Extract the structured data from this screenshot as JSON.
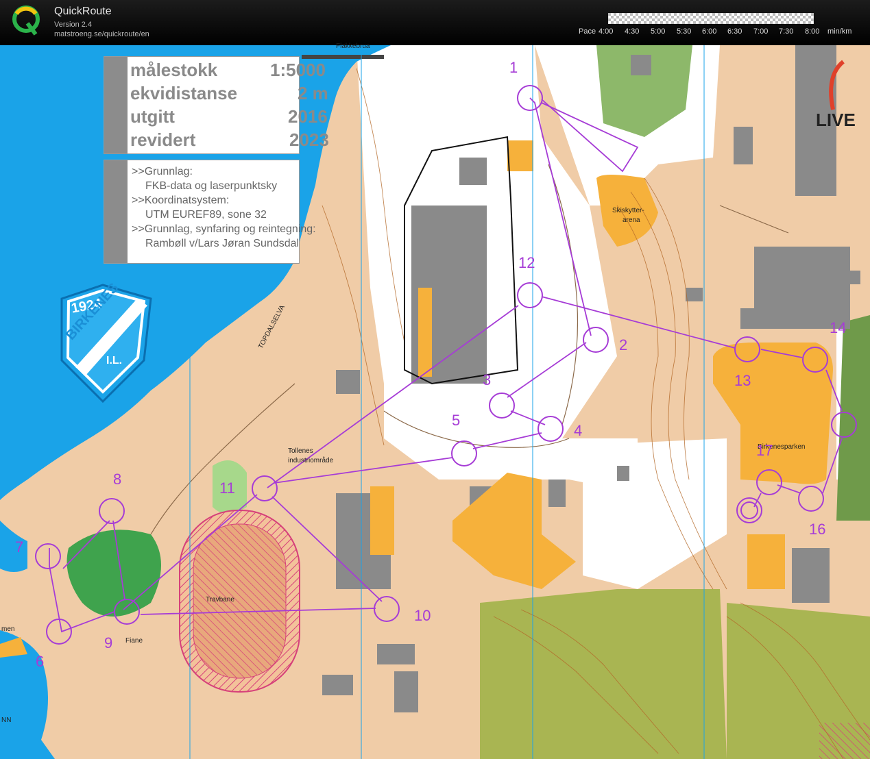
{
  "app": {
    "name": "QuickRoute",
    "version": "Version 2.4",
    "url": "matstroeng.se/quickroute/en"
  },
  "pace_scale": {
    "label": "Pace",
    "ticks": [
      "4:00",
      "4:30",
      "5:00",
      "5:30",
      "6:00",
      "6:30",
      "7:00",
      "7:30",
      "8:00"
    ],
    "unit": "min/km"
  },
  "map_info": {
    "scale_label": "målestokk",
    "scale_value": "1:5000",
    "contour_label": "ekvidistanse",
    "contour_value": "2 m",
    "published_label": "utgitt",
    "published_value": "2016",
    "revised_label": "revidert",
    "revised_value": "2023",
    "notes": [
      ">>Grunnlag:",
      "FKB-data og laserpunktsky",
      ">>Koordinatsystem:",
      "UTM EUREF89, sone 32",
      ">>Grunnlag, synfaring og reintegning:",
      "Rambøll v/Lars Jøran Sundsdal"
    ]
  },
  "club_logo": {
    "year": "1924",
    "name": "BIRKENES",
    "suffix": "I.L."
  },
  "live_logo_text": "LIVE",
  "place_labels": {
    "hakkebrua": "Flakkebrua",
    "skiskytter": "Skiskytter-",
    "skiskytter2": "arena",
    "topdalselva": "TOPDALSELVA",
    "tollenes": "Tollenes",
    "tollenes2": "industriområde",
    "birkenesparken": "Birkenesparken",
    "travbane": "Travbane",
    "fiane": "Fiane",
    "men": "men",
    "nn": "NN"
  },
  "controls": [
    {
      "n": "1"
    },
    {
      "n": "2"
    },
    {
      "n": "3"
    },
    {
      "n": "4"
    },
    {
      "n": "5"
    },
    {
      "n": "6"
    },
    {
      "n": "7"
    },
    {
      "n": "8"
    },
    {
      "n": "9"
    },
    {
      "n": "10"
    },
    {
      "n": "11"
    },
    {
      "n": "12"
    },
    {
      "n": "13"
    },
    {
      "n": "14"
    },
    {
      "n": "16"
    },
    {
      "n": "17"
    }
  ],
  "colors": {
    "course": "#a63cd6",
    "water": "#1aa3e8",
    "building": "#8a8a8a",
    "paved": "#efc49e",
    "field": "#f6b13b",
    "vegetation": "#4f8a2e"
  }
}
